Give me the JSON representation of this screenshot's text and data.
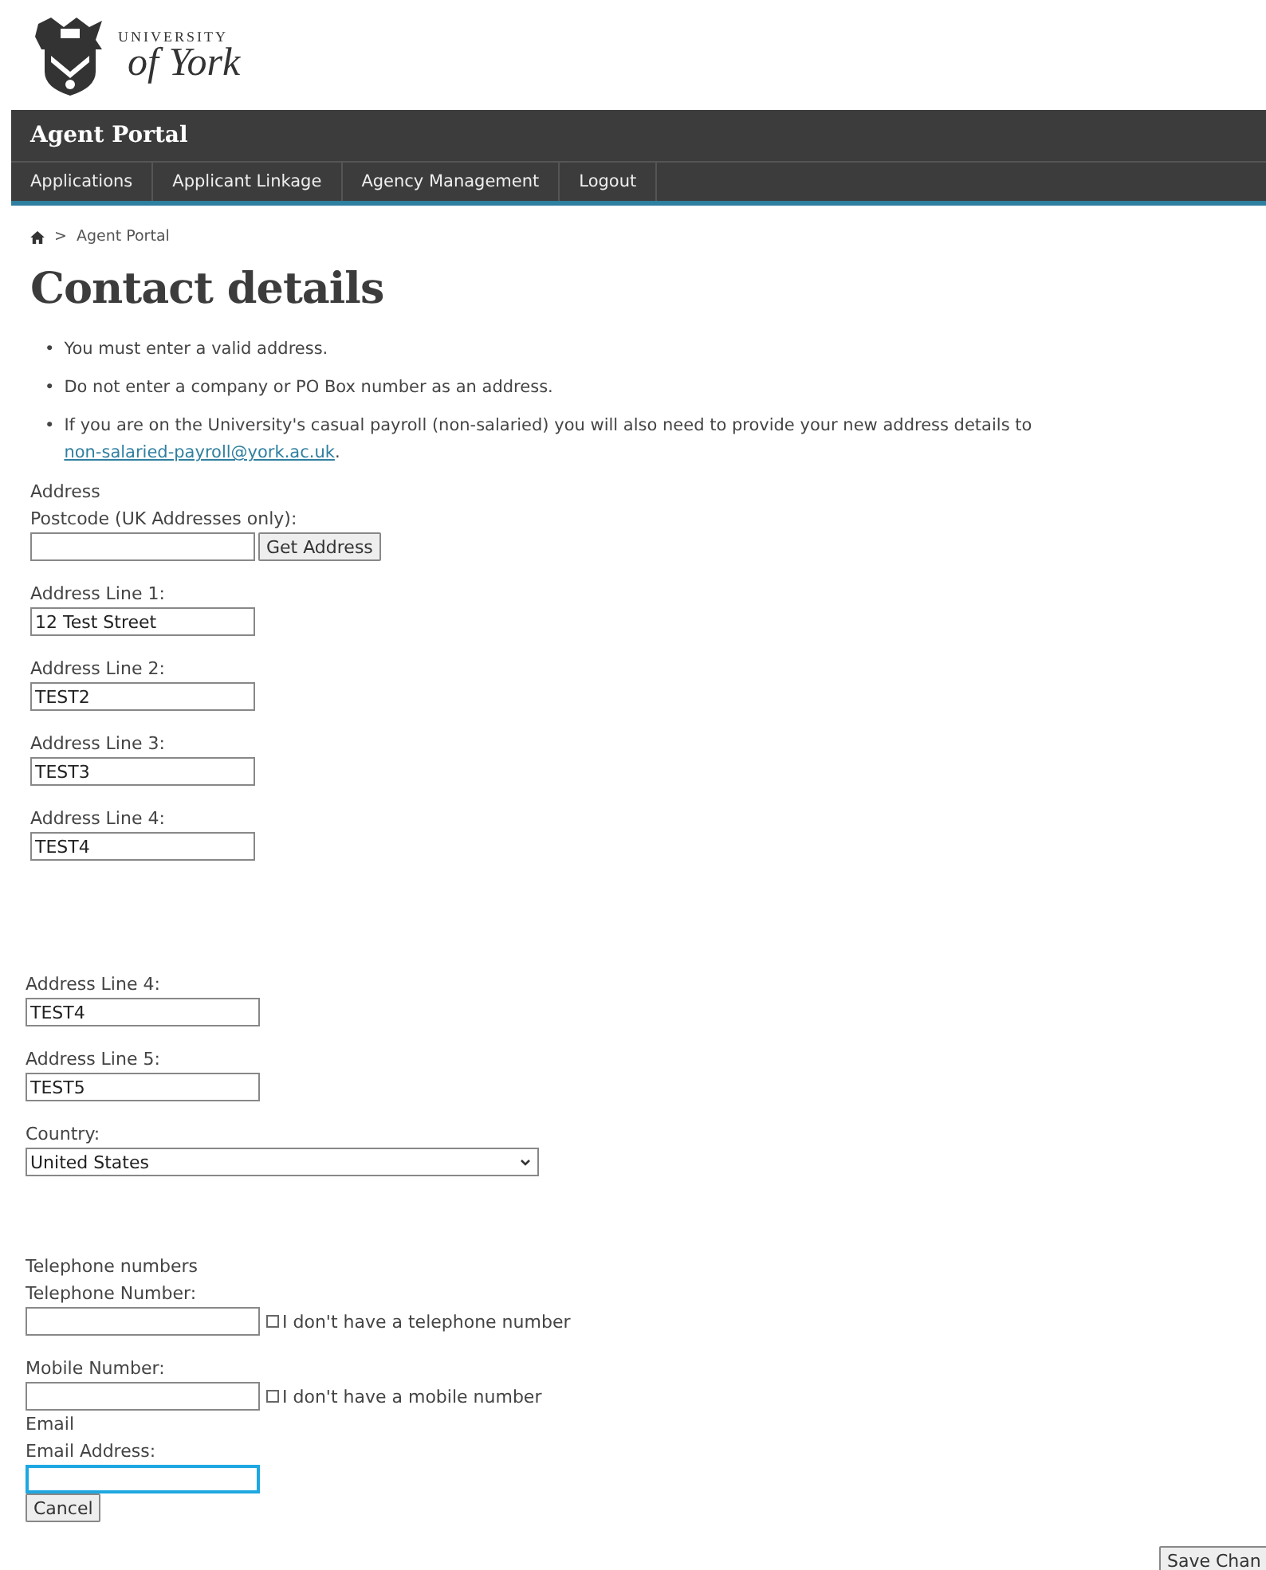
{
  "logo": {
    "line_1": "UNIVERSITY",
    "line_2": "of York"
  },
  "header": {
    "title": "Agent Portal"
  },
  "nav": [
    {
      "label": "Applications"
    },
    {
      "label": "Applicant Linkage"
    },
    {
      "label": "Agency Management"
    },
    {
      "label": "Logout"
    }
  ],
  "breadcrumb": {
    "current": "Agent Portal",
    "separator": ">"
  },
  "page_title": "Contact details",
  "notes": [
    {
      "bullet": "•",
      "text": "You must enter a valid address."
    },
    {
      "bullet": "•",
      "text": "Do not enter a company or PO Box number as an address."
    },
    {
      "bullet": "•",
      "text": "If you are on the University's casual payroll (non-salaried) you will also need to provide your new address details to ",
      "link": "non-salaried-payroll@york.ac.uk",
      "after": "."
    }
  ],
  "address": {
    "heading": "Address",
    "postcode": {
      "label": "Postcode (UK Addresses only):",
      "button": "Get Address"
    },
    "lines": [
      {
        "label": "Address Line 1:",
        "value": "12 Test Street"
      },
      {
        "label": "Address Line 2:",
        "value": "TEST2"
      },
      {
        "label": "Address Line 3:",
        "value": "TEST3"
      },
      {
        "label": "Address Line 4:",
        "value": "TEST4"
      }
    ]
  },
  "address_more": {
    "lines": [
      {
        "label": "Address Line 4:",
        "value": "TEST4"
      },
      {
        "label": "Address Line 5:",
        "value": "TEST5"
      }
    ],
    "country": {
      "label": "Country:",
      "value": "United States"
    }
  },
  "telephone": {
    "heading": "Telephone numbers",
    "fields": [
      {
        "label": "Telephone Number:",
        "checkbox": "I don't have a telephone number",
        "checked": false
      },
      {
        "label": "Mobile Number:",
        "checkbox": "I don't have a mobile number",
        "checked": false
      }
    ]
  },
  "email": {
    "heading": "Email",
    "label": "Email Address:",
    "focused": true
  },
  "buttons": [
    {
      "label": "Cancel",
      "kind": "cancel"
    },
    {
      "label": "Save Chan",
      "kind": "save"
    }
  ]
}
